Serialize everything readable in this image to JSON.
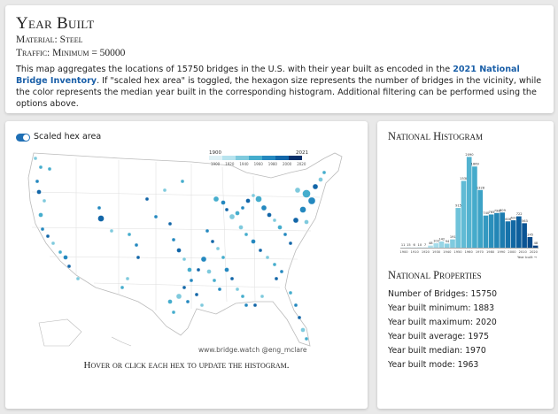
{
  "header": {
    "title": "Year Built",
    "material": "Material: Steel",
    "traffic": "Traffic: Minimum = 50000",
    "desc_pre": "This map aggregates the locations of 15750 bridges in the U.S. with their year built as encoded in the ",
    "desc_link": "2021 National Bridge Inventory",
    "desc_post": ". If \"scaled hex area\" is toggled, the hexagon size represents the number of bridges in the vicinity, while the color represents the median year built in the corresponding histogram. Additional filtering can be performed using the options above."
  },
  "map": {
    "toggle_label": "Scaled hex area",
    "legend_min": "1900",
    "legend_max": "2021",
    "legend_ticks": [
      "1900",
      "1920",
      "1940",
      "1960",
      "1980",
      "2000",
      "2020"
    ],
    "watermark": "www.bridge.watch @eng_mclare",
    "caption": "Hover or click each hex to update the histogram."
  },
  "histogram": {
    "title": "National Histogram",
    "x_axis_label": "Year built",
    "x_ticks": [
      "1900",
      "1910",
      "1920",
      "1930",
      "1940",
      "1950",
      "1960",
      "1970",
      "1980",
      "1990",
      "2000",
      "2010",
      "2020"
    ]
  },
  "chart_data": {
    "type": "bar",
    "title": "National Histogram",
    "xlabel": "Year built",
    "ylabel": "",
    "categories": [
      "1880",
      "1885",
      "1890",
      "1895",
      "1900",
      "1905",
      "1910",
      "1915",
      "1920",
      "1925",
      "1930",
      "1935",
      "1940",
      "1945",
      "1950",
      "1955",
      "1960",
      "1965",
      "1970",
      "1975",
      "1980",
      "1985",
      "1990",
      "1995",
      "2000",
      "2005",
      "2010",
      "2015",
      "2020"
    ],
    "values": [
      11,
      15,
      6,
      10,
      7,
      48,
      102,
      142,
      94,
      191,
      915,
      1538,
      2090,
      1869,
      1328,
      740,
      765,
      798,
      809,
      606,
      631,
      722,
      563,
      245,
      48
    ],
    "ylim": [
      0,
      2200
    ]
  },
  "properties": {
    "title": "National Properties",
    "items": [
      "Number of Bridges: 15750",
      "Year built minimum: 1883",
      "Year built maximum: 2020",
      "Year built average: 1975",
      "Year built median: 1970",
      "Year built mode: 1963"
    ]
  },
  "colors": {
    "accent": "#1f6fb5",
    "light": "#c8e7ef",
    "dark": "#08306b"
  }
}
